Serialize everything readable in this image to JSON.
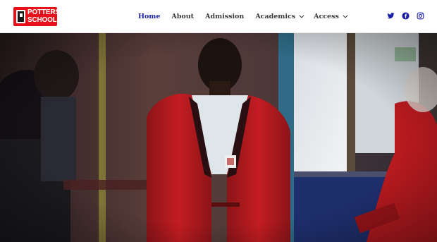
{
  "logo": {
    "line1": "POTTERS",
    "line2": "SCHOOLS"
  },
  "nav": {
    "items": [
      {
        "label": "Home",
        "active": true,
        "dropdown": false
      },
      {
        "label": "About",
        "active": false,
        "dropdown": false
      },
      {
        "label": "Admission",
        "active": false,
        "dropdown": false
      },
      {
        "label": "Academics",
        "active": false,
        "dropdown": true
      },
      {
        "label": "Access",
        "active": false,
        "dropdown": true
      }
    ]
  },
  "social": {
    "icons": [
      "twitter-icon",
      "facebook-icon",
      "instagram-icon"
    ],
    "color": "#1b1fa6"
  },
  "hero": {
    "image": "photo of students in a classroom, student in red school blazer"
  },
  "colors": {
    "brand_red": "#e8101a",
    "accent_blue": "#1b1fa6",
    "nav_text": "#3a3a3a"
  }
}
